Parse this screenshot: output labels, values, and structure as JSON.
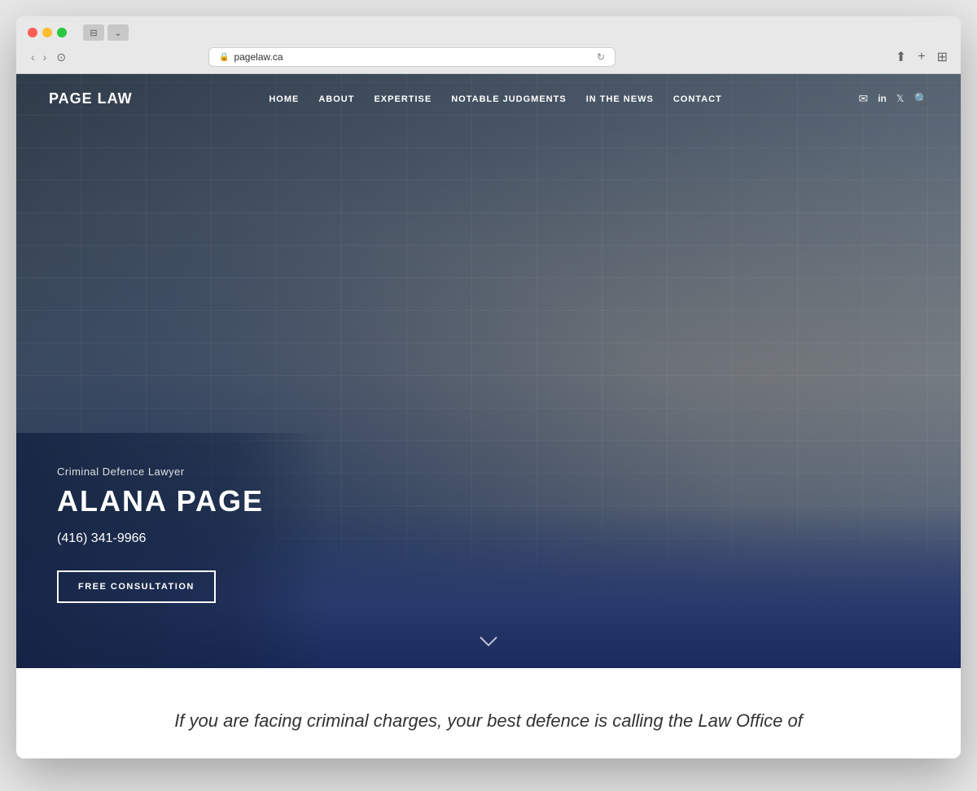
{
  "browser": {
    "url": "pagelaw.ca",
    "back_btn": "‹",
    "forward_btn": "›"
  },
  "nav": {
    "logo": "PAGE LAW",
    "links": [
      {
        "label": "HOME",
        "id": "home"
      },
      {
        "label": "ABOUT",
        "id": "about"
      },
      {
        "label": "EXPERTISE",
        "id": "expertise"
      },
      {
        "label": "NOTABLE JUDGMENTS",
        "id": "notable-judgments"
      },
      {
        "label": "IN THE NEWS",
        "id": "in-the-news"
      },
      {
        "label": "CONTACT",
        "id": "contact"
      }
    ]
  },
  "hero": {
    "subtitle": "Criminal Defence Lawyer",
    "title": "ALANA PAGE",
    "phone": "(416) 341-9966",
    "cta_label": "FREE CONSULTATION"
  },
  "below_hero": {
    "text": "If you are facing criminal charges, your best defence is calling the Law Office of"
  },
  "icons": {
    "email": "✉",
    "linkedin": "in",
    "twitter": "𝕏",
    "search": "🔍",
    "lock": "🔒",
    "reload": "↻",
    "share": "⬆",
    "add_tab": "+",
    "tab_grid": "⊞",
    "shield": "⊙",
    "scroll_down": "∨"
  }
}
